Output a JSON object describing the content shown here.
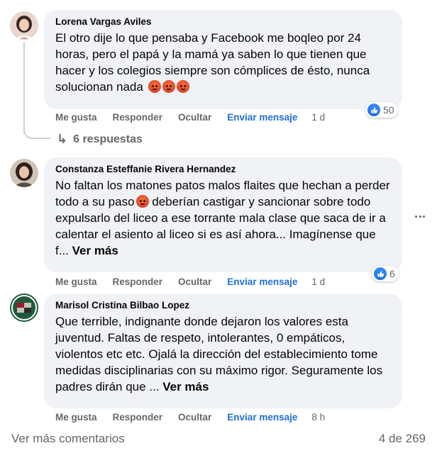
{
  "comments": [
    {
      "author": "Lorena Vargas Aviles",
      "text": "El otro dije lo que pensaba y Facebook me boqleo por 24 horas, pero el papá y la mamá ya saben lo que tienen que hacer y los colegios siempre son cómplices de ésto, nunca solucionan nada",
      "emojis": [
        "angry-face-emoji",
        "angry-face-emoji",
        "angry-face-emoji"
      ],
      "actions": {
        "like": "Me gusta",
        "reply": "Responder",
        "hide": "Ocultar",
        "message": "Enviar mensaje",
        "time": "1 d"
      },
      "reaction_count": "50",
      "replies_label": "6 respuestas"
    },
    {
      "author": "Constanza Esteffanie Rivera Hernandez",
      "text_before_emoji": "No faltan los matones patos malos flaites que hechan a perder todo a su paso",
      "text_after_emoji": " deberían castigar y sancionar sobre todo expulsarlo del liceo a ese torrante mala clase que saca de ir a calentar el asiento al liceo si es así ahora... Imagínense que f... ",
      "see_more": "Ver más",
      "actions": {
        "like": "Me gusta",
        "reply": "Responder",
        "hide": "Ocultar",
        "message": "Enviar mensaje",
        "time": "1 d"
      },
      "reaction_count": "6"
    },
    {
      "author": "Marisol Cristina Bilbao Lopez",
      "text": "Que terrible, indignante donde dejaron los valores esta juventud. Faltas de respeto, intolerantes, 0 empáticos, violentos etc etc. Ojalá la dirección del establecimiento tome medidas disciplinarias con su máximo rigor. Seguramente los padres dirán que ... ",
      "see_more": "Ver más",
      "actions": {
        "like": "Me gusta",
        "reply": "Responder",
        "hide": "Ocultar",
        "message": "Enviar mensaje",
        "time": "8 h"
      }
    }
  ],
  "footer": {
    "more_comments": "Ver más comentarios",
    "count": "4 de 269"
  },
  "colors": {
    "bubble": "#f0f2f5",
    "secondary_text": "#65676b",
    "link_blue": "#216fdb",
    "like_blue": "#1b6ee0"
  }
}
